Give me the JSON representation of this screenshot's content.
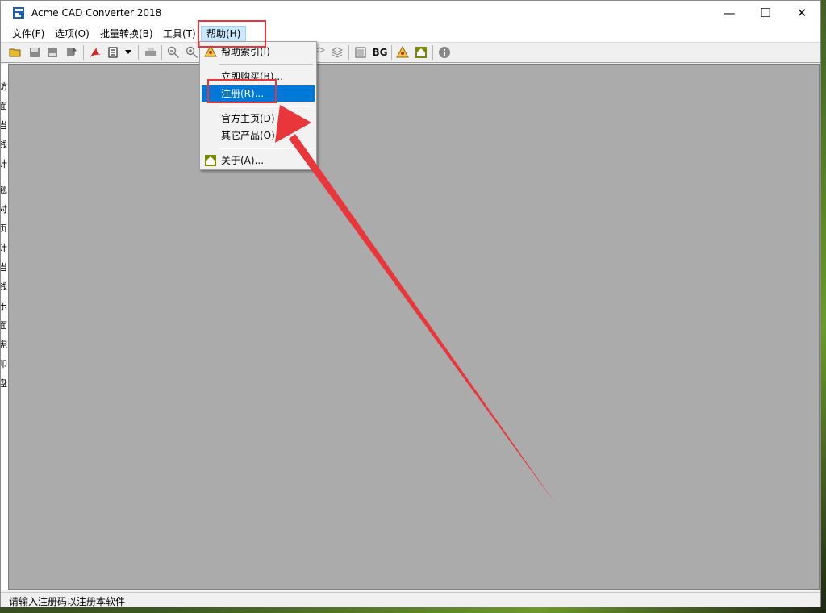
{
  "window": {
    "title": "Acme CAD Converter 2018",
    "minimize": "—",
    "maximize": "☐",
    "close": "✕"
  },
  "menubar": {
    "items": [
      "文件(F)",
      "选项(O)",
      "批量转换(B)",
      "工具(T)",
      "帮助(H)"
    ]
  },
  "toolbar": {
    "bg_label": "BG"
  },
  "help_menu": {
    "items": [
      "帮助索引(I)",
      "立即购买(B)...",
      "注册(R)...",
      "官方主页(D)",
      "其它产品(O)",
      "关于(A)..."
    ],
    "highlighted": "注册(R)..."
  },
  "left_strip": {
    "chars": [
      "访",
      "面",
      "当",
      "钱",
      "计",
      "翘",
      "对",
      "页",
      "计",
      "当",
      "钱",
      "乐",
      "面",
      "宪",
      "叩",
      "盘"
    ]
  },
  "status": {
    "text": "请输入注册码以注册本软件"
  },
  "annotations": {
    "color": "#e8363a"
  },
  "colors": {
    "highlight": "#0078d7",
    "workspace": "#ababab"
  }
}
